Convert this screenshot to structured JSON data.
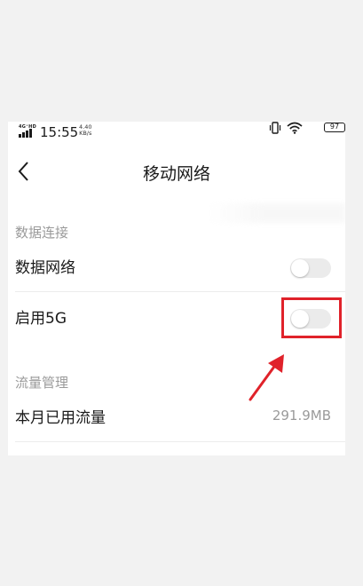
{
  "status_bar": {
    "network": "4G⁺HD",
    "time": "15:55",
    "speed_value": "4.40",
    "speed_unit": "KB/s",
    "battery": "97"
  },
  "header": {
    "back_icon": "chevron-left-icon",
    "title": "移动网络"
  },
  "sections": {
    "data_connection": {
      "title": "数据连接",
      "rows": [
        {
          "label": "数据网络",
          "toggle_on": false
        },
        {
          "label": "启用5G",
          "toggle_on": false
        }
      ]
    },
    "traffic": {
      "title": "流量管理",
      "rows": [
        {
          "label": "本月已用流量",
          "value": "291.9MB"
        }
      ]
    }
  },
  "annotation": {
    "highlight_color": "#e0222a",
    "target": "启用5G toggle"
  },
  "colors": {
    "page_bg": "#f2f2f2",
    "toggle_off_track": "#ebebeb",
    "secondary_text": "#9a9a9a",
    "primary_text": "#1a1a1a"
  }
}
